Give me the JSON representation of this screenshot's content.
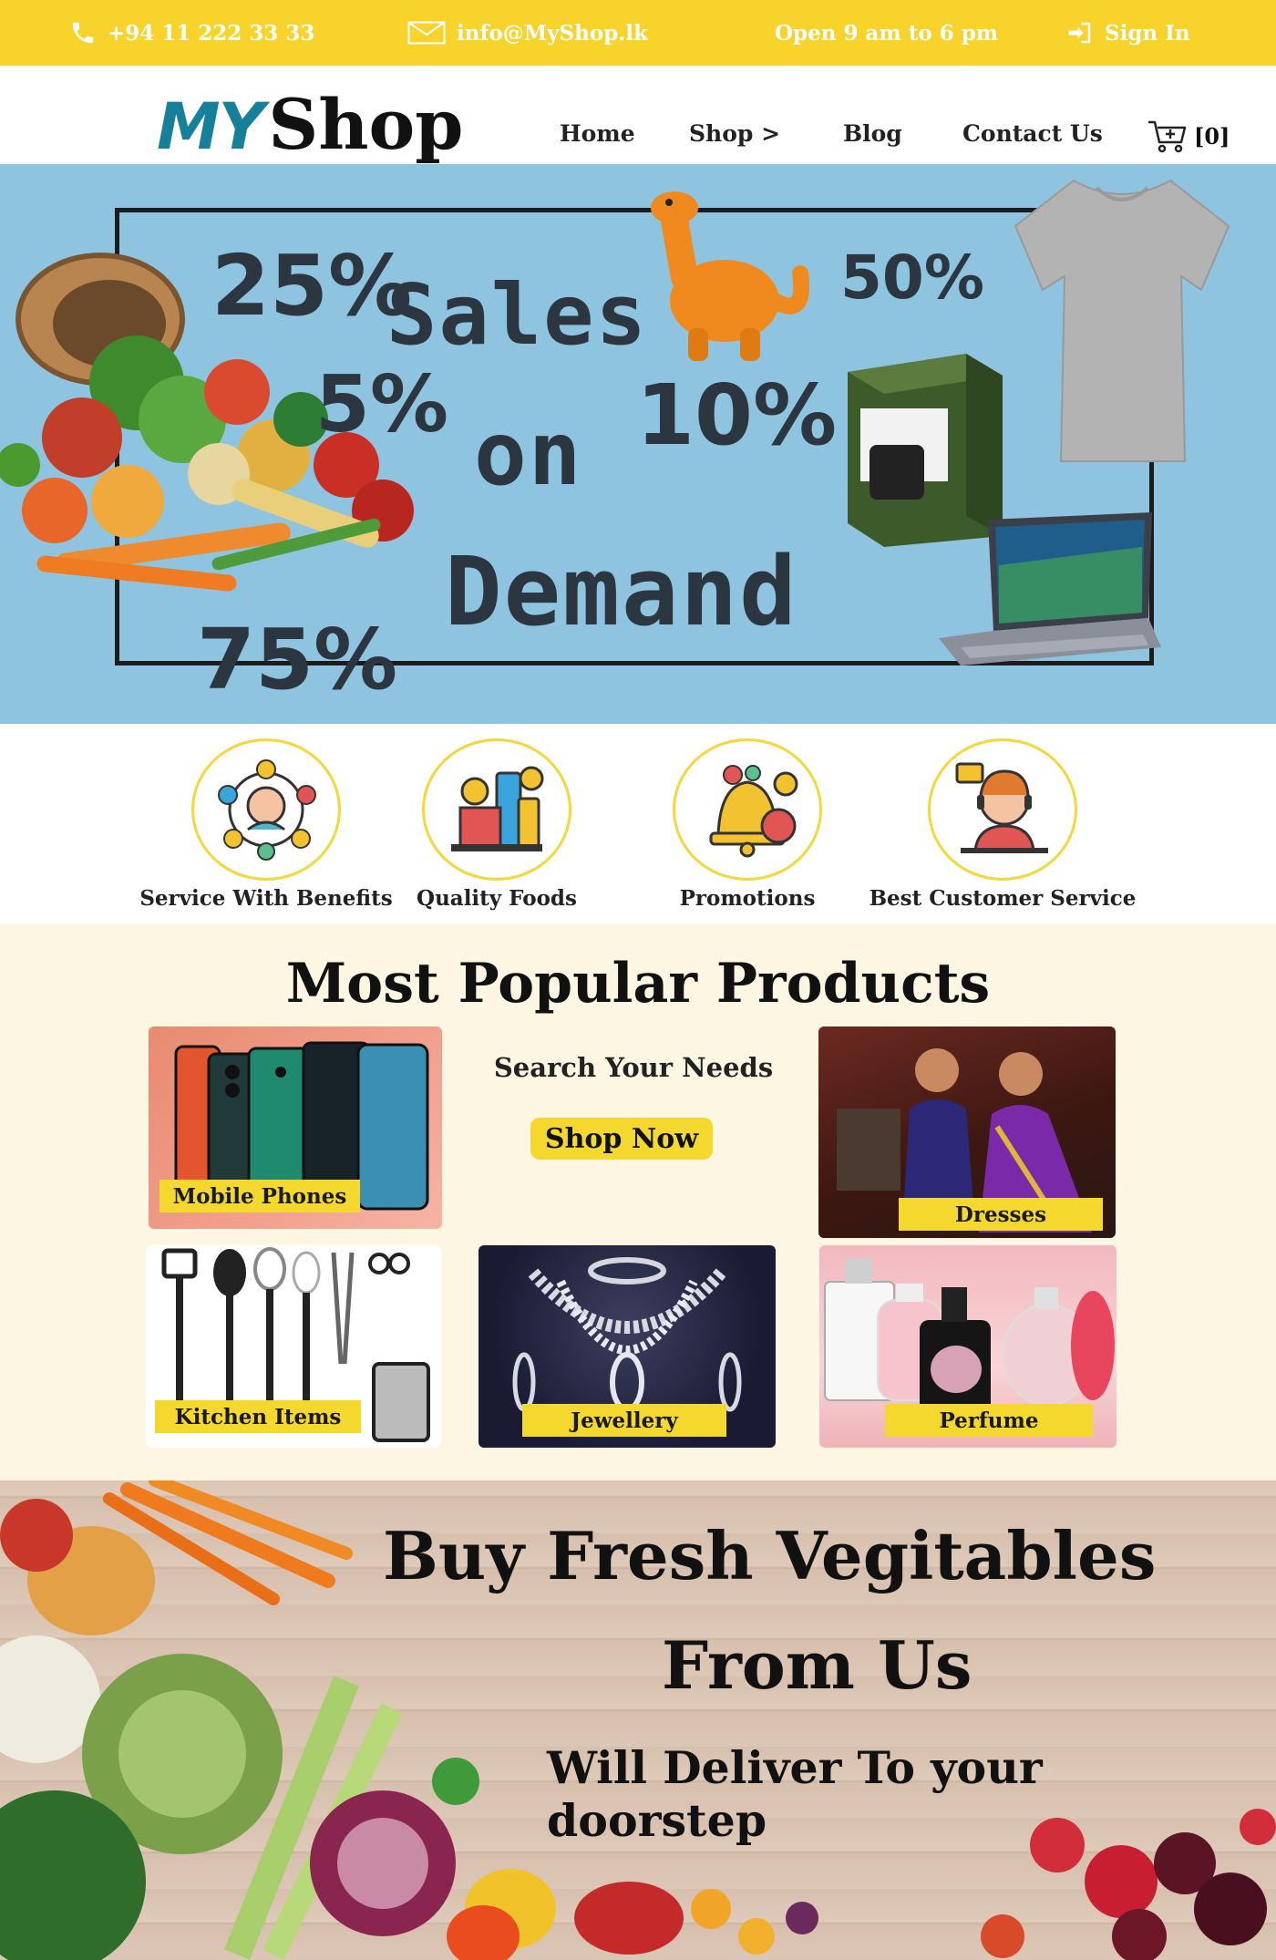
{
  "topbar": {
    "phone": "+94 11 222 33 33",
    "email": "info@MyShop.lk",
    "hours": "Open 9 am to 6 pm",
    "signin": "Sign In"
  },
  "brand": {
    "my": "MY",
    "shop": "Shop"
  },
  "nav": {
    "home": "Home",
    "shop": "Shop >",
    "blog": "Blog",
    "contact": "Contact Us",
    "cart_count": "[0]"
  },
  "hero": {
    "p25": "25%",
    "p50": "50%",
    "p5": "5%",
    "p10": "10%",
    "p75": "75%",
    "line1": "Sales",
    "line2": "on",
    "line3": "Demand"
  },
  "features": [
    {
      "label": "Service With Benefits"
    },
    {
      "label": "Quality Foods"
    },
    {
      "label": "Promotions"
    },
    {
      "label": "Best Customer Service"
    }
  ],
  "popular": {
    "title": "Most Popular Products",
    "search_text": "Search Your Needs",
    "shop_now": "Shop Now",
    "categories": {
      "phones": "Mobile Phones",
      "dresses": "Dresses",
      "kitchen": "Kitchen Items",
      "jewellery": "Jewellery",
      "perfume": "Perfume"
    }
  },
  "fresh": {
    "line1": "Buy Fresh Vegitables",
    "line2": "From Us",
    "line3": "Will Deliver To your doorstep"
  },
  "colors": {
    "accent_yellow": "#f7d32b",
    "brand_teal": "#16809b",
    "hero_blue": "#8ec4df",
    "cream": "#fdf6e2"
  }
}
